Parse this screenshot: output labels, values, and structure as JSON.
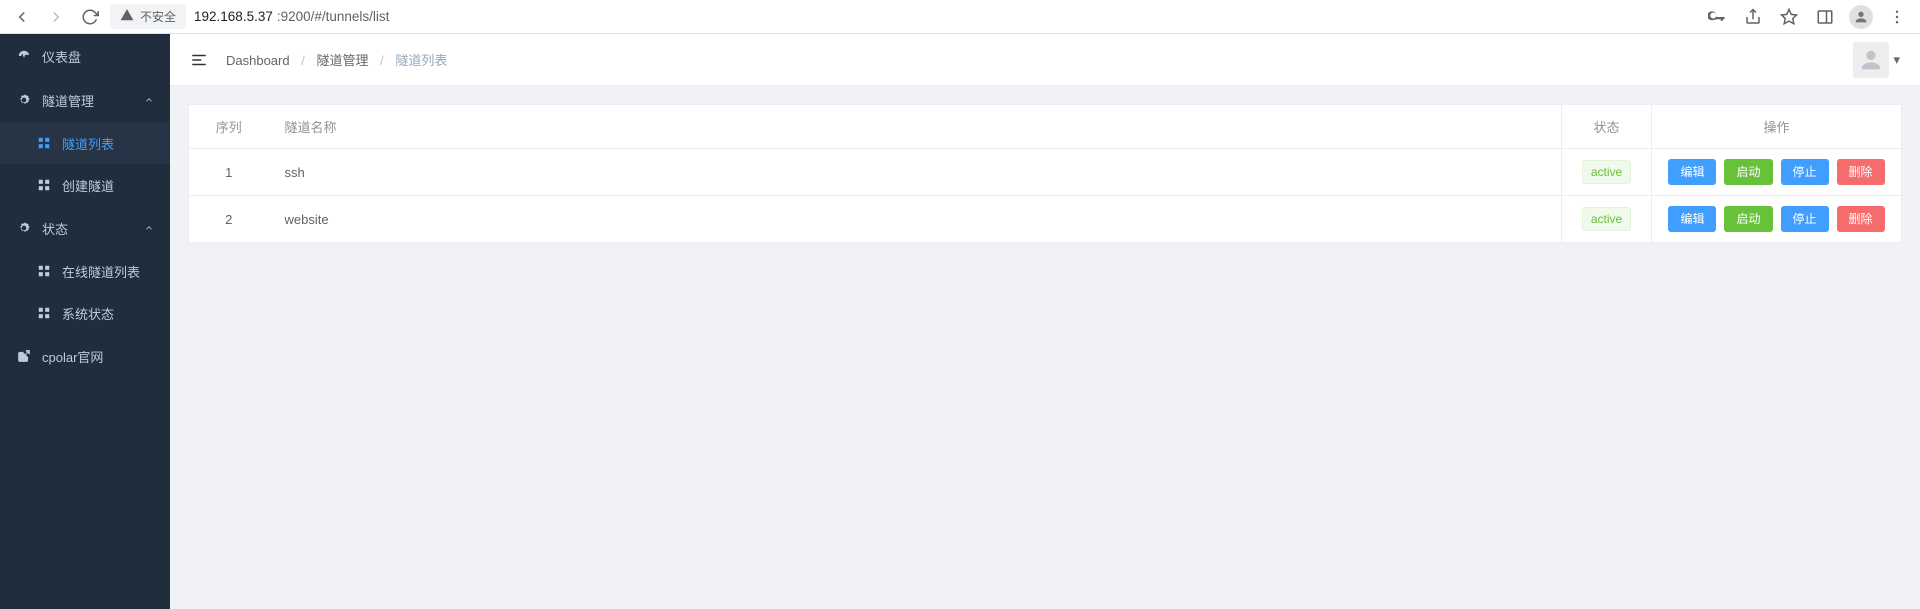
{
  "browser": {
    "security_label": "不安全",
    "url_host": "192.168.5.37",
    "url_port": ":9200",
    "url_path": "/#/tunnels/list"
  },
  "sidebar": {
    "dashboard": "仪表盘",
    "tunnel_mgmt": "隧道管理",
    "tunnel_list": "隧道列表",
    "create_tunnel": "创建隧道",
    "status": "状态",
    "online_tunnel_list": "在线隧道列表",
    "system_status": "系统状态",
    "cpolar_site": "cpolar官网"
  },
  "breadcrumb": {
    "dashboard": "Dashboard",
    "tunnel_mgmt": "隧道管理",
    "tunnel_list": "隧道列表"
  },
  "table": {
    "columns": {
      "seq": "序列",
      "name": "隧道名称",
      "status": "状态",
      "actions": "操作"
    },
    "rows": [
      {
        "seq": "1",
        "name": "ssh",
        "status": "active"
      },
      {
        "seq": "2",
        "name": "website",
        "status": "active"
      }
    ],
    "buttons": {
      "edit": "编辑",
      "start": "启动",
      "stop": "停止",
      "delete": "删除"
    }
  }
}
